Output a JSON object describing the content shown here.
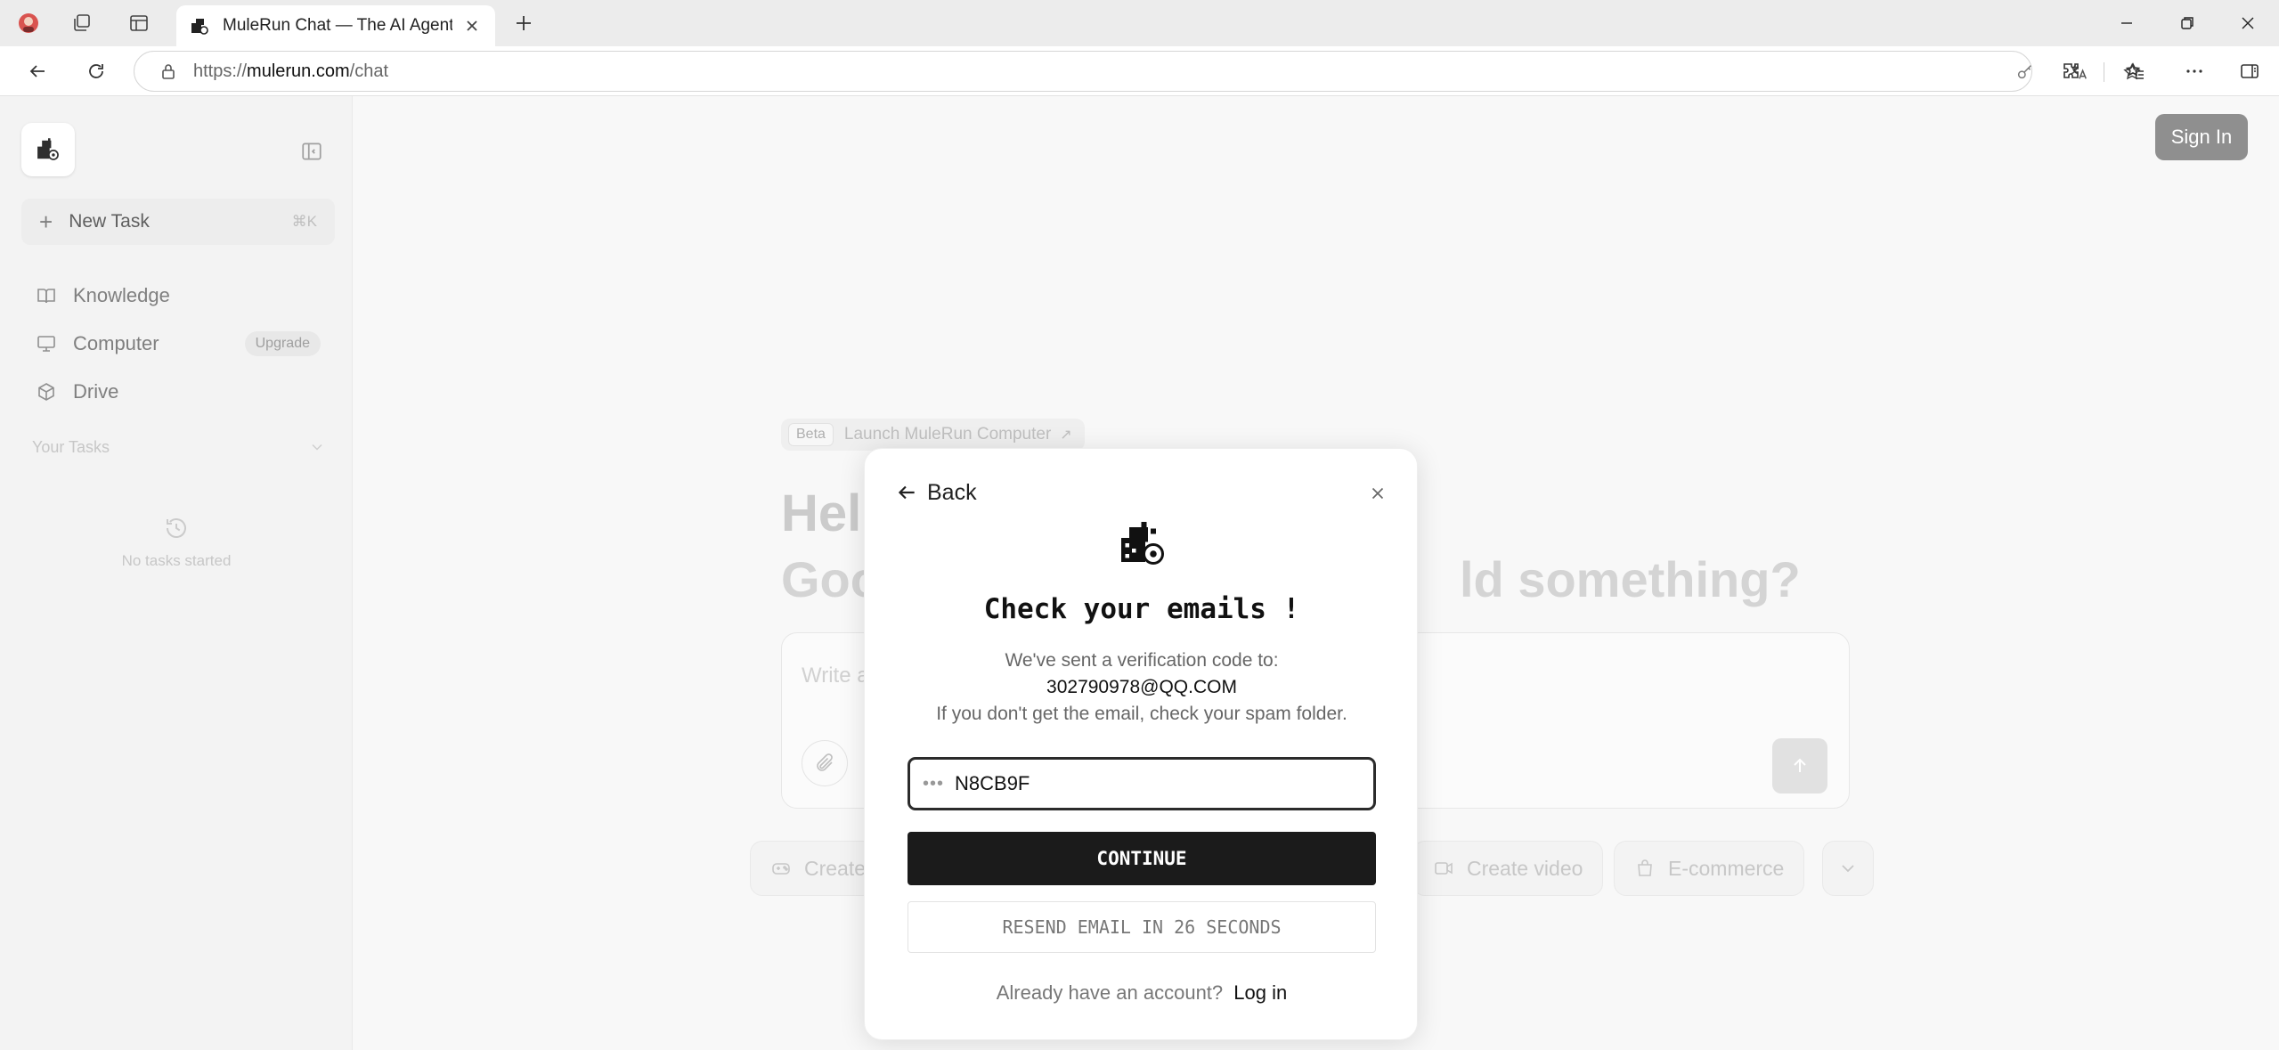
{
  "browser": {
    "tab_title": "MuleRun Chat — The AI Agent Th",
    "url_host": "mulerun.com",
    "url_path": "/chat",
    "url_scheme": "https://"
  },
  "sidebar": {
    "new_task_label": "New Task",
    "new_task_shortcut": "⌘K",
    "items": [
      {
        "label": "Knowledge",
        "icon": "book-icon"
      },
      {
        "label": "Computer",
        "icon": "monitor-icon",
        "badge": "Upgrade"
      },
      {
        "label": "Drive",
        "icon": "cube-icon"
      }
    ],
    "your_tasks_label": "Your Tasks",
    "empty_tasks": "No tasks started"
  },
  "header": {
    "sign_in": "Sign In"
  },
  "main": {
    "beta_badge": "Beta",
    "launch_label": "Launch MuleRun Computer",
    "hello": "Hell",
    "greet_left": "Goo",
    "greet_right": "ld something?",
    "chat_placeholder": "Write a",
    "chips": [
      {
        "label": "Create",
        "icon": "gamepad-icon"
      },
      {
        "label": "Create video",
        "icon": "video-icon"
      },
      {
        "label": "E-commerce",
        "icon": "shopping-bag-icon"
      }
    ]
  },
  "modal": {
    "back_label": "Back",
    "title": "Check your emails !",
    "sent_line": "We've sent a verification code to:",
    "email": "302790978@QQ.COM",
    "spam_line": "If you don't get the email, check your spam folder.",
    "code_value": "N8CB9F",
    "continue_label": "CONTINUE",
    "resend_label": "RESEND EMAIL IN 26 SECONDS",
    "footer_text": "Already have an account?",
    "login_label": "Log in"
  },
  "colors": {
    "accent_dark": "#1b1b1b",
    "sign_in_bg": "#888888",
    "page_bg": "#f8f8f8"
  }
}
